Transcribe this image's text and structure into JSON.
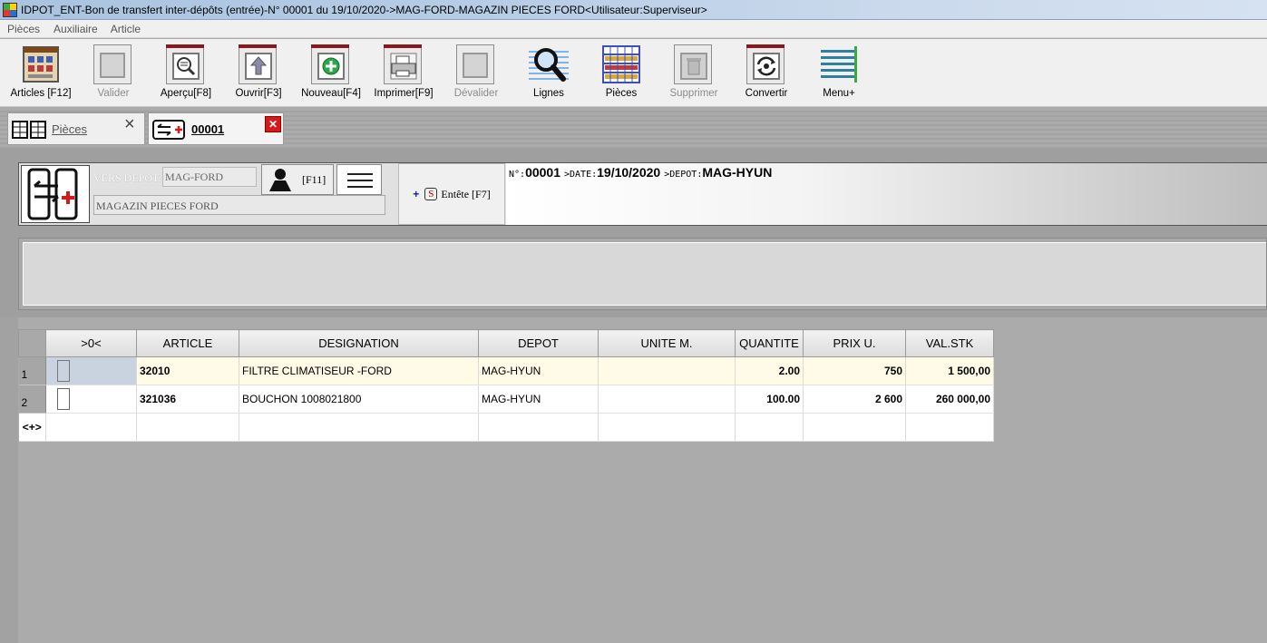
{
  "window": {
    "title": "IDPOT_ENT-Bon de transfert inter-dépôts (entrée)-N° 00001 du 19/10/2020->MAG-FORD-MAGAZIN PIECES FORD<Utilisateur:Superviseur>"
  },
  "menu": [
    "Pièces",
    "Auxiliaire",
    "Article"
  ],
  "toolbar": [
    {
      "label": "Articles [F12]",
      "icon": "articles-icon",
      "enabled": true
    },
    {
      "label": "Valider",
      "icon": "validate-icon",
      "enabled": false
    },
    {
      "label": "Aperçu[F8]",
      "icon": "preview-icon",
      "enabled": true
    },
    {
      "label": "Ouvrir[F3]",
      "icon": "open-icon",
      "enabled": true
    },
    {
      "label": "Nouveau[F4]",
      "icon": "new-icon",
      "enabled": true
    },
    {
      "label": "Imprimer[F9]",
      "icon": "printer-icon",
      "enabled": true
    },
    {
      "label": "Dévalider",
      "icon": "unvalidate-icon",
      "enabled": false
    },
    {
      "label": "Lignes",
      "icon": "magnifier-icon",
      "enabled": true
    },
    {
      "label": "Pièces",
      "icon": "grid-icon",
      "enabled": true
    },
    {
      "label": "Supprimer",
      "icon": "trash-icon",
      "enabled": false
    },
    {
      "label": "Convertir",
      "icon": "convert-icon",
      "enabled": true
    },
    {
      "label": "Menu+",
      "icon": "menu-lines-icon",
      "enabled": true
    }
  ],
  "tabs": {
    "pieces": "Pièces",
    "current": "00001",
    "close": "×",
    "close_active": "✕"
  },
  "header": {
    "vers_depot_label": "VERS DEPOT:",
    "vers_depot_value": "MAG-FORD",
    "depot_name": "MAGAZIN PIECES FORD",
    "user_key": "[F11]",
    "entete_plus": "+",
    "entete_s": "S",
    "entete_label": "Entête [F7]",
    "num_key": "N°:",
    "num_value": "00001",
    "date_key": ">DATE:",
    "date_value": "19/10/2020",
    "depot_key": ">DEPOT:",
    "depot_value": "MAG-HYUN"
  },
  "grid": {
    "columns": [
      "",
      ">0<",
      "ARTICLE",
      "DESIGNATION",
      "DEPOT",
      "UNITE M.",
      "QUANTITE",
      "PRIX U.",
      "VAL.STK"
    ],
    "rows": [
      {
        "n": "1",
        "article": "32010",
        "designation": "FILTRE CLIMATISEUR -FORD",
        "depot": "MAG-HYUN",
        "unite": "",
        "quantite": "2.00",
        "prix": "750",
        "val": "1 500,00"
      },
      {
        "n": "2",
        "article": "321036",
        "designation": "BOUCHON 1008021800",
        "depot": "MAG-HYUN",
        "unite": "",
        "quantite": "100.00",
        "prix": "2 600",
        "val": "260 000,00"
      }
    ],
    "add_row_marker": "<+>"
  }
}
